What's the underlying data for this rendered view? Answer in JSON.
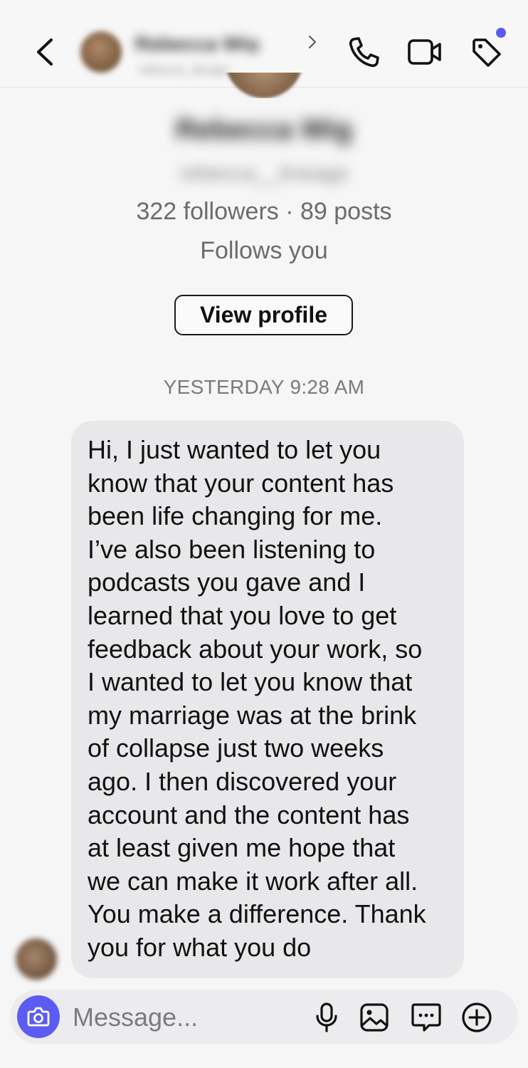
{
  "header": {
    "name": "Rebecca Wig",
    "handle": "rebecca_design"
  },
  "profile": {
    "name": "Rebecca Wig",
    "handle": "rebecca__lineage",
    "stats": "322 followers · 89 posts",
    "follows_you": "Follows you",
    "view_profile_label": "View profile"
  },
  "thread": {
    "timestamp": "YESTERDAY 9:28 AM",
    "message": "Hi, I just wanted to let you\nknow that your content has\nbeen life changing for me.\nI’ve also been listening to\npodcasts you gave and I\nlearned that you love to get\nfeedback about your work, so\nI wanted to let you know that\nmy marriage was at the brink\nof collapse just two weeks\nago. I then discovered your\naccount and the content has\nat least given me hope that\nwe can make it work after all.\nYou make a difference. Thank\nyou for what you do"
  },
  "composer": {
    "placeholder": "Message..."
  },
  "icons": {
    "back": "chevron-left-icon",
    "call": "phone-icon",
    "video": "video-camera-icon",
    "tag": "tag-icon",
    "camera": "camera-icon",
    "mic": "microphone-icon",
    "image": "image-icon",
    "sticker": "sticker-icon",
    "plus": "plus-circle-icon"
  },
  "colors": {
    "accent": "#5c5cf2",
    "bubble": "#e8e8eb",
    "background": "#f6f6f6"
  }
}
